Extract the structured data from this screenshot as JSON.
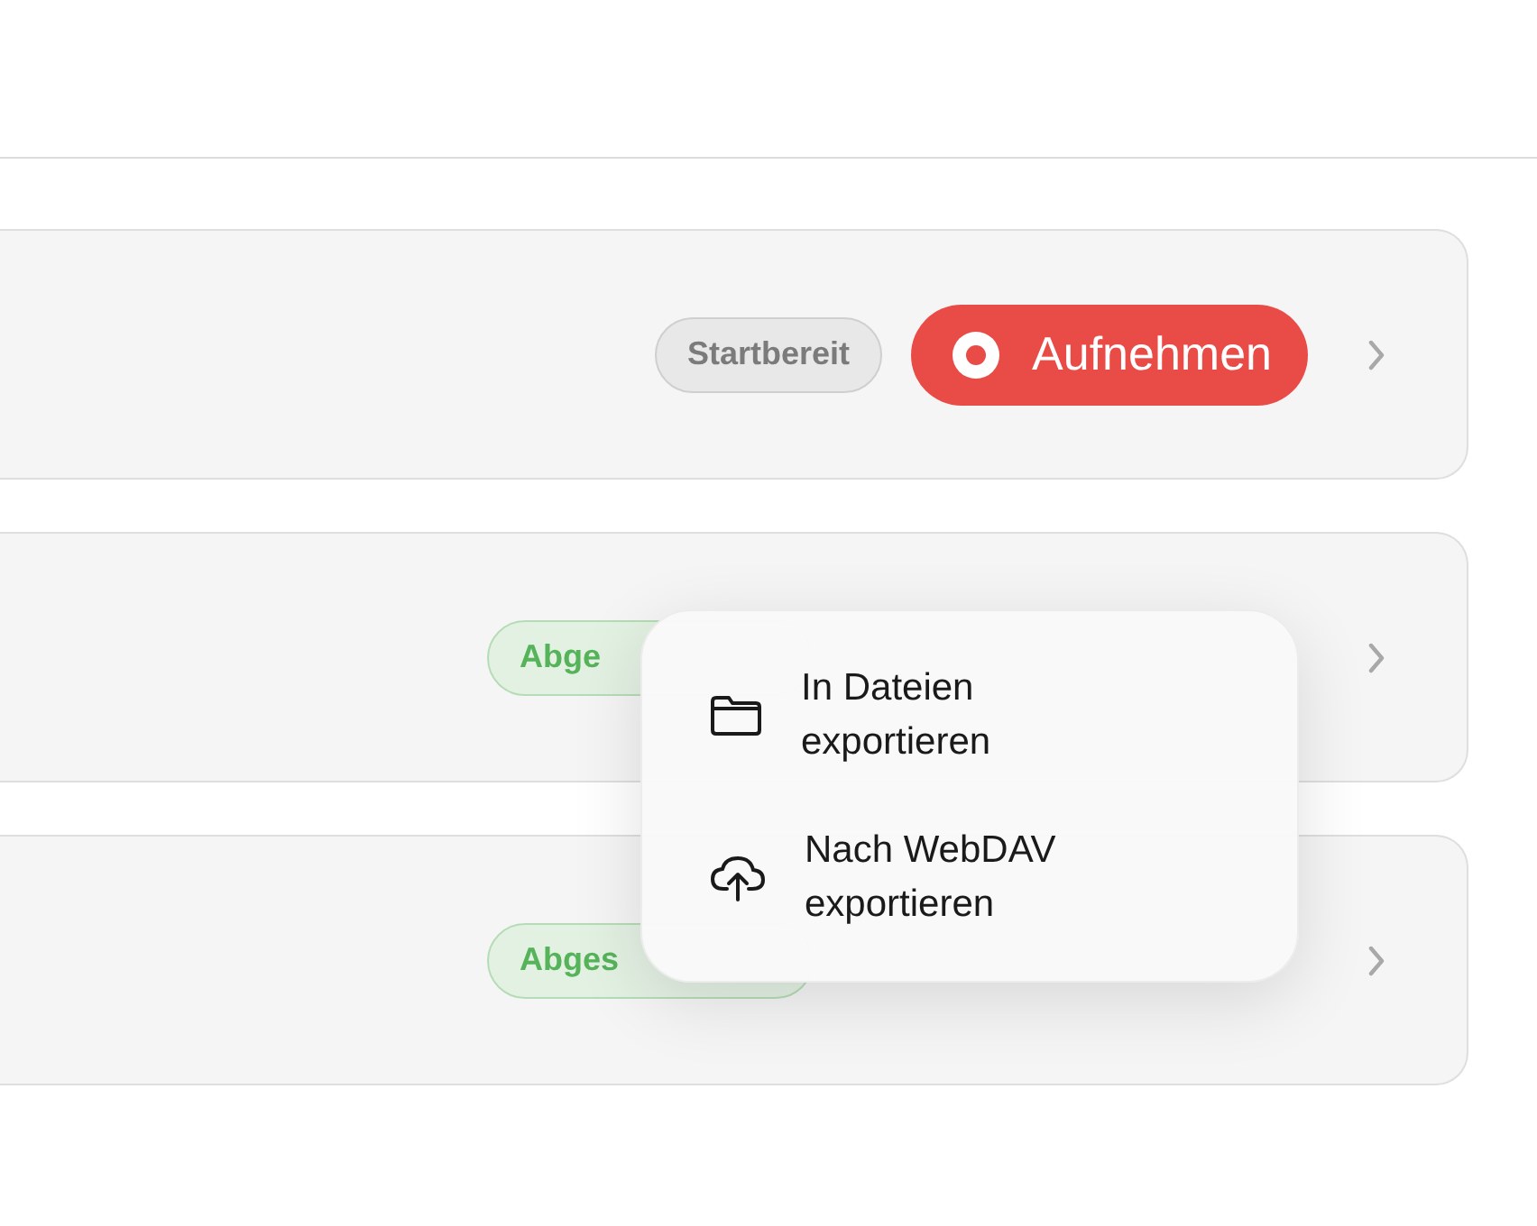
{
  "rows": [
    {
      "status": {
        "label": "Startbereit",
        "kind": "ready"
      },
      "action": {
        "label": "Aufnehmen",
        "kind": "record"
      }
    },
    {
      "status": {
        "label": "Abge",
        "kind": "done"
      }
    },
    {
      "status": {
        "label": "Abges",
        "kind": "done"
      }
    }
  ],
  "menu": {
    "items": [
      {
        "label": "In Dateien exportieren",
        "kind": "folder"
      },
      {
        "label": "Nach WebDAV exportieren",
        "kind": "upload"
      }
    ]
  }
}
